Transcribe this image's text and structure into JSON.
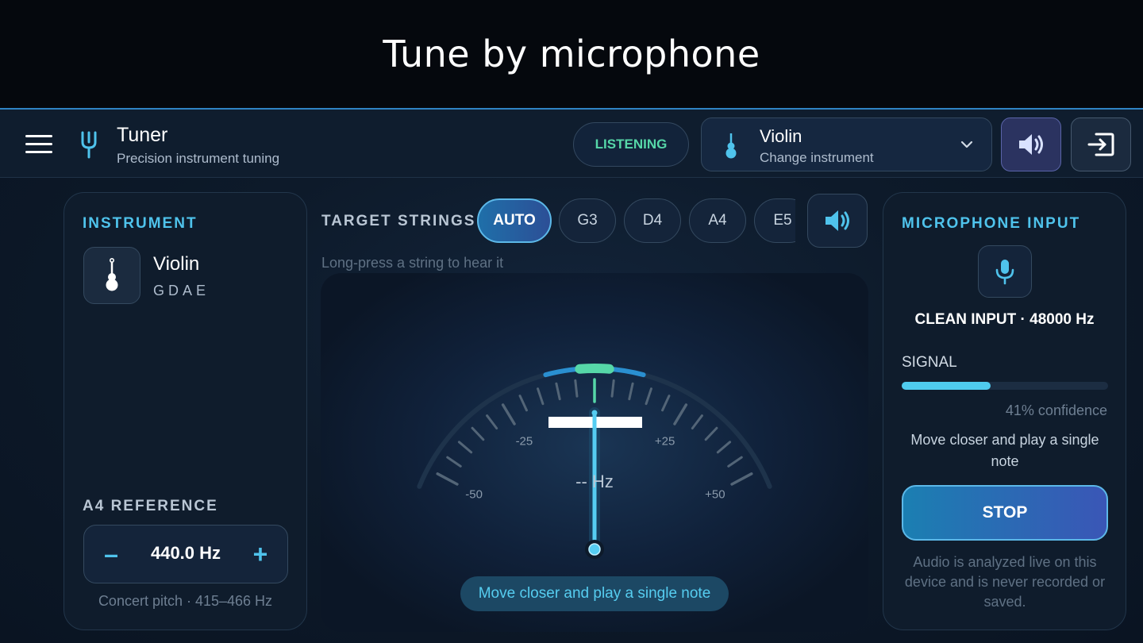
{
  "banner": {
    "title": "Tune by microphone"
  },
  "header": {
    "app_title": "Tuner",
    "app_subtitle": "Precision instrument tuning",
    "status": "LISTENING",
    "instrument_select": {
      "name": "Violin",
      "subtitle": "Change instrument"
    },
    "icons": [
      "menu-icon",
      "tuning-fork-icon",
      "violin-icon",
      "chevron-down-icon",
      "speaker-icon",
      "exit-icon"
    ]
  },
  "instrument_panel": {
    "label": "INSTRUMENT",
    "name": "Violin",
    "strings": "GDAE",
    "reference_label": "A4 REFERENCE",
    "reference_value": "440.0 Hz",
    "reference_minus": "–",
    "reference_plus": "+",
    "reference_note": "Concert pitch · 415–466 Hz"
  },
  "target": {
    "label": "TARGET STRINGS",
    "chips": [
      "AUTO",
      "G3",
      "D4",
      "A4",
      "E5"
    ],
    "selected": "AUTO",
    "hint": "Long-press a string to hear it"
  },
  "gauge": {
    "tick_labels": [
      "-50",
      "-25",
      "+25",
      "+50"
    ],
    "range_cents": [
      -50,
      50
    ],
    "needle_cents": 0,
    "readout": "-- Hz",
    "status": "Move closer and play a single note"
  },
  "mic_panel": {
    "label": "MICROPHONE INPUT",
    "input_info": "CLEAN INPUT · 48000 Hz",
    "signal_label": "SIGNAL",
    "signal_level": 0.43,
    "confidence": "41% confidence",
    "advice": "Move closer and play a single note",
    "stop_label": "STOP",
    "privacy": "Audio is analyzed live on this device and is never recorded or saved."
  },
  "colors": {
    "accent": "#4fc3ec",
    "listening": "#56d7a8",
    "in_tune": "#56d7a8"
  }
}
